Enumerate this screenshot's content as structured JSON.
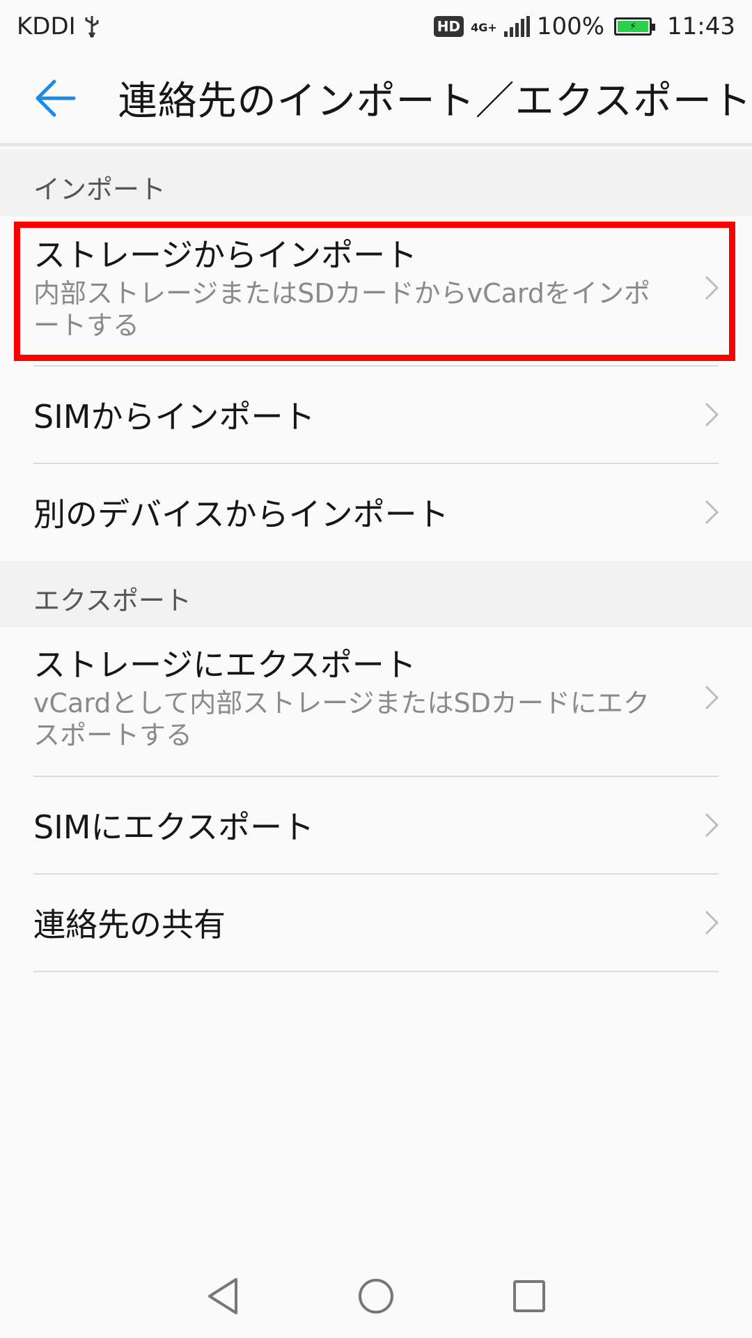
{
  "status_bar": {
    "carrier": "KDDI",
    "hd": "HD",
    "network": "4G+",
    "battery": "100%",
    "time": "11:43"
  },
  "app_bar": {
    "title": "連絡先のインポート／エクスポート",
    "back_icon": "back-arrow-icon"
  },
  "sections": {
    "import": {
      "header": "インポート",
      "items": [
        {
          "title": "ストレージからインポート",
          "subtitle": "内部ストレージまたはSDカードからvCardをインポートする"
        },
        {
          "title": "SIMからインポート"
        },
        {
          "title": "別のデバイスからインポート"
        }
      ]
    },
    "export": {
      "header": "エクスポート",
      "items": [
        {
          "title": "ストレージにエクスポート",
          "subtitle": "vCardとして内部ストレージまたはSDカードにエクスポートする"
        },
        {
          "title": "SIMにエクスポート"
        },
        {
          "title": "連絡先の共有"
        }
      ]
    }
  },
  "colors": {
    "accent": "#1e88e5",
    "highlight": "#ff0000",
    "battery": "#2bcf4a"
  }
}
